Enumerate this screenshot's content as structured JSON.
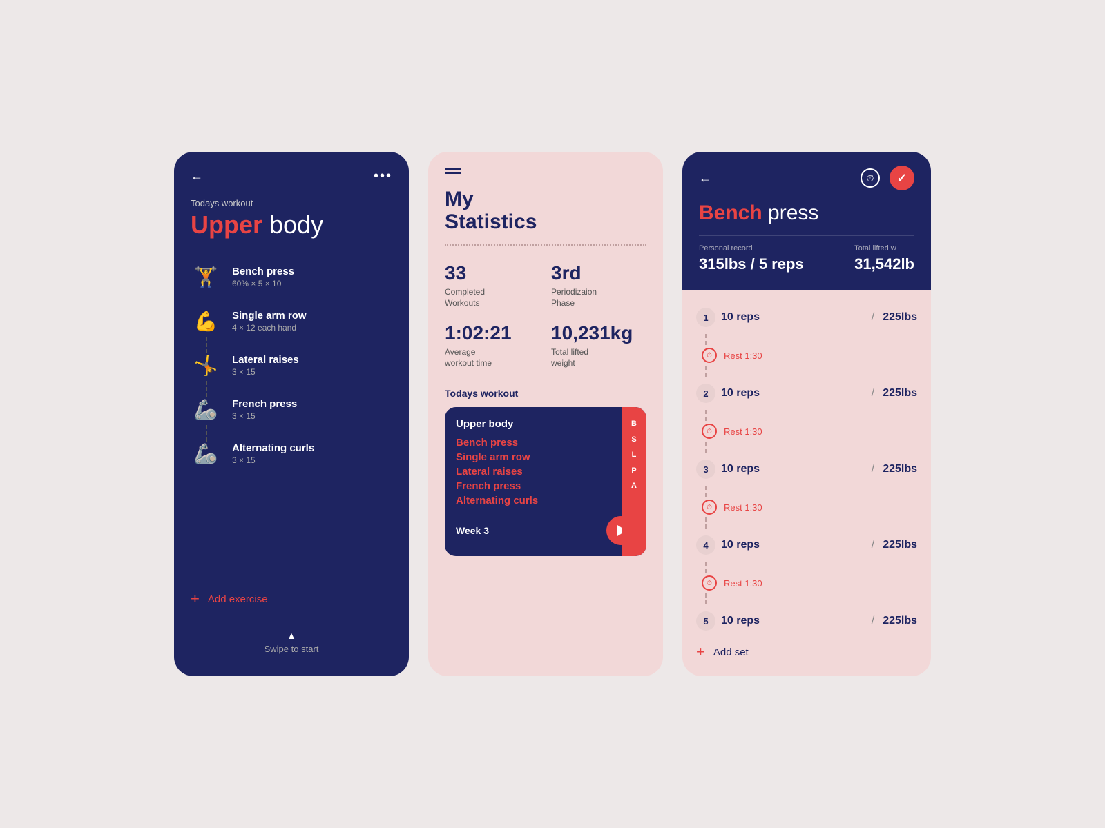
{
  "screen1": {
    "back_label": "←",
    "more_label": "•••",
    "todays_label": "Todays workout",
    "title_highlight": "Upper",
    "title_normal": " body",
    "exercises": [
      {
        "name": "Bench press",
        "detail": "60% × 5 × 10",
        "icon": "🏋"
      },
      {
        "name": "Single arm row",
        "detail": "4 × 12 each hand",
        "icon": "💪"
      },
      {
        "name": "Lateral raises",
        "detail": "3 × 15",
        "icon": "🤸"
      },
      {
        "name": "French press",
        "detail": "3 × 15",
        "icon": "🦾"
      },
      {
        "name": "Alternating curls",
        "detail": "3 × 15",
        "icon": "🦾"
      }
    ],
    "add_exercise_label": "Add exercise",
    "swipe_label": "Swipe to start"
  },
  "screen2": {
    "stats_title": "My\nStatistics",
    "stats": [
      {
        "value": "33",
        "label": "Completed\nWorkouts"
      },
      {
        "value": "3rd",
        "label": "Periodizaion\nPhase"
      },
      {
        "value": "1:02:21",
        "label": "Average\nworkout time"
      },
      {
        "value": "10,231kg",
        "label": "Total lifted\nweight"
      }
    ],
    "todays_label": "Todays workout",
    "workout_card": {
      "title": "Upper body",
      "exercises": [
        "Bench press",
        "Single arm row",
        "Lateral raises",
        "French press",
        "Alternating curls"
      ],
      "side_letters": [
        "B",
        "S",
        "L",
        "P",
        "A"
      ],
      "week_label": "Week 3"
    }
  },
  "screen3": {
    "back_label": "←",
    "title_highlight": "Bench",
    "title_normal": " press",
    "personal_record_label": "Personal record",
    "personal_record_value": "315lbs / 5 reps",
    "total_lifted_label": "Total lifted w",
    "total_lifted_value": "31,542lb",
    "sets": [
      {
        "num": "1",
        "reps": "10 reps",
        "weight": "225lbs"
      },
      {
        "num": "2",
        "reps": "10 reps",
        "weight": "225lbs"
      },
      {
        "num": "3",
        "reps": "10 reps",
        "weight": "225lbs"
      },
      {
        "num": "4",
        "reps": "10 reps",
        "weight": "225lbs"
      },
      {
        "num": "5",
        "reps": "10 reps",
        "weight": "225lbs"
      }
    ],
    "rest_label": "Rest 1:30",
    "add_set_label": "Add set",
    "slash": "/"
  },
  "colors": {
    "navy": "#1e2461",
    "red": "#e84444",
    "pink_bg": "#f2d8d8",
    "light_pink": "#ede8e8"
  }
}
